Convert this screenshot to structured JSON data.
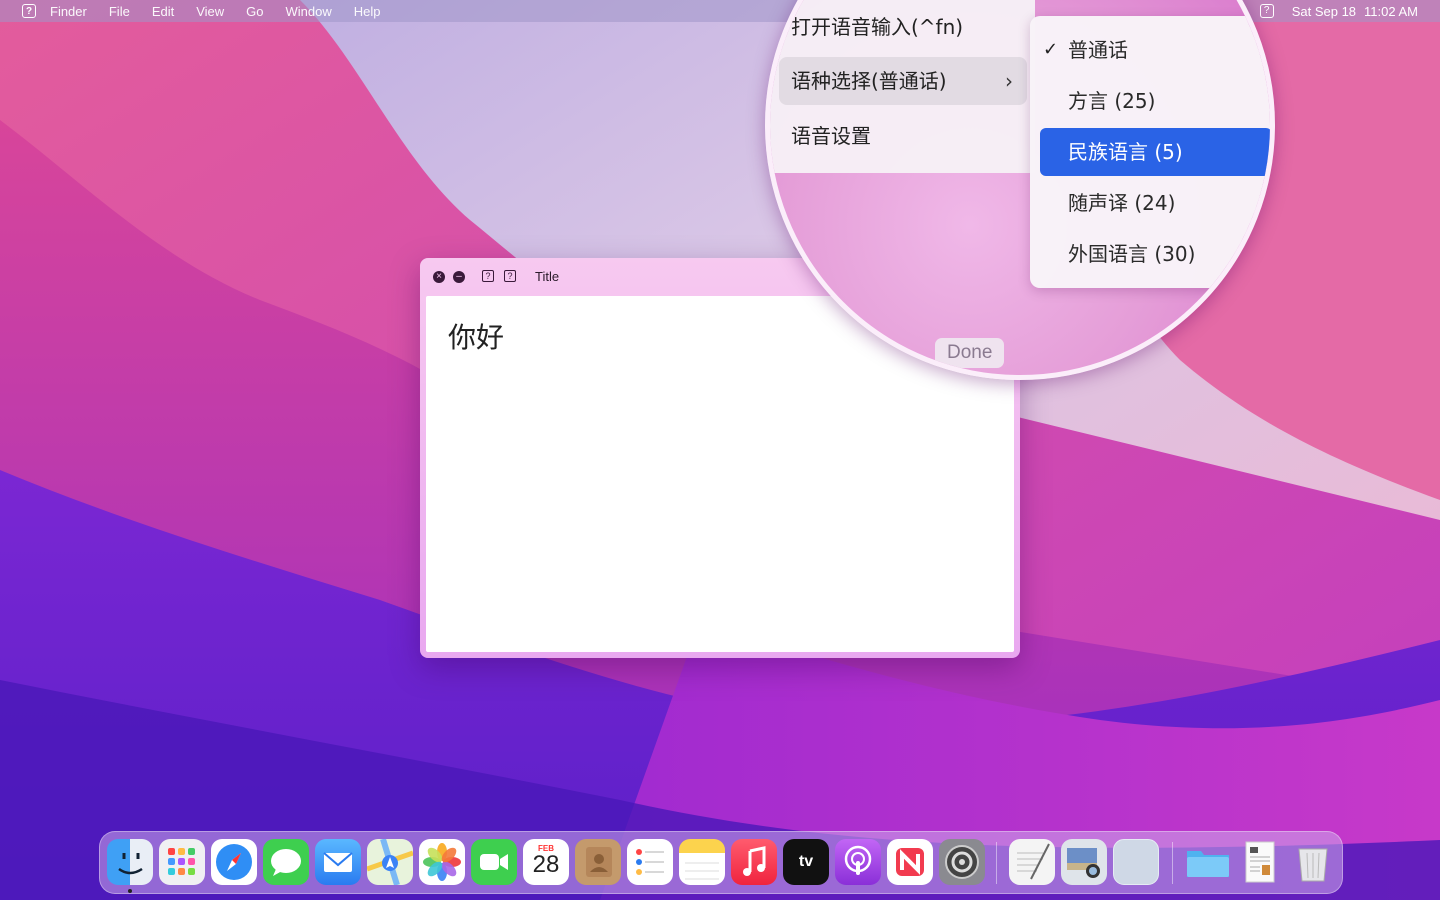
{
  "menubar": {
    "app_menu_icon": "help-square-icon",
    "items": [
      "Finder",
      "File",
      "Edit",
      "View",
      "Go",
      "Window",
      "Help"
    ],
    "status_icon": "help-square-icon",
    "date": "Sat Sep 18",
    "time": "11:02 AM"
  },
  "window": {
    "title": "Title",
    "controls": [
      "close-icon",
      "minimize-icon",
      "help-square-icon",
      "help-square-icon"
    ],
    "text": "你好",
    "done_label": "Done"
  },
  "magnifier": {
    "menu": {
      "items": [
        {
          "label": "打开语音输入(^fn)"
        },
        {
          "label": "语种选择(普通话)",
          "has_submenu": true
        },
        {
          "label": "语音设置"
        }
      ]
    },
    "submenu": {
      "items": [
        {
          "label": "普通话",
          "checked": true
        },
        {
          "label": "方言 (25)"
        },
        {
          "label": "民族语言 (5)",
          "highlighted": true
        },
        {
          "label": "随声译 (24)"
        },
        {
          "label": "外国语言 (30)"
        }
      ]
    },
    "done_label": "Done"
  },
  "dock": {
    "apps": [
      {
        "name": "finder-icon"
      },
      {
        "name": "launchpad-icon"
      },
      {
        "name": "safari-icon"
      },
      {
        "name": "messages-icon"
      },
      {
        "name": "mail-icon"
      },
      {
        "name": "maps-icon"
      },
      {
        "name": "photos-icon"
      },
      {
        "name": "facetime-icon"
      },
      {
        "name": "calendar-icon"
      },
      {
        "name": "contacts-icon"
      },
      {
        "name": "reminders-icon"
      },
      {
        "name": "notes-icon"
      },
      {
        "name": "music-icon"
      },
      {
        "name": "apple-tv-icon"
      },
      {
        "name": "podcasts-icon"
      },
      {
        "name": "news-icon"
      },
      {
        "name": "system-preferences-icon"
      },
      {
        "name": "textedit-icon"
      },
      {
        "name": "preview-icon"
      },
      {
        "name": "blank-app-icon"
      },
      {
        "name": "folder-icon"
      },
      {
        "name": "document-icon"
      },
      {
        "name": "trash-icon"
      }
    ],
    "calendar_month": "FEB",
    "calendar_day": "28",
    "tv_label": "tv",
    "colors": {
      "highlight": "#2a63e6"
    }
  }
}
